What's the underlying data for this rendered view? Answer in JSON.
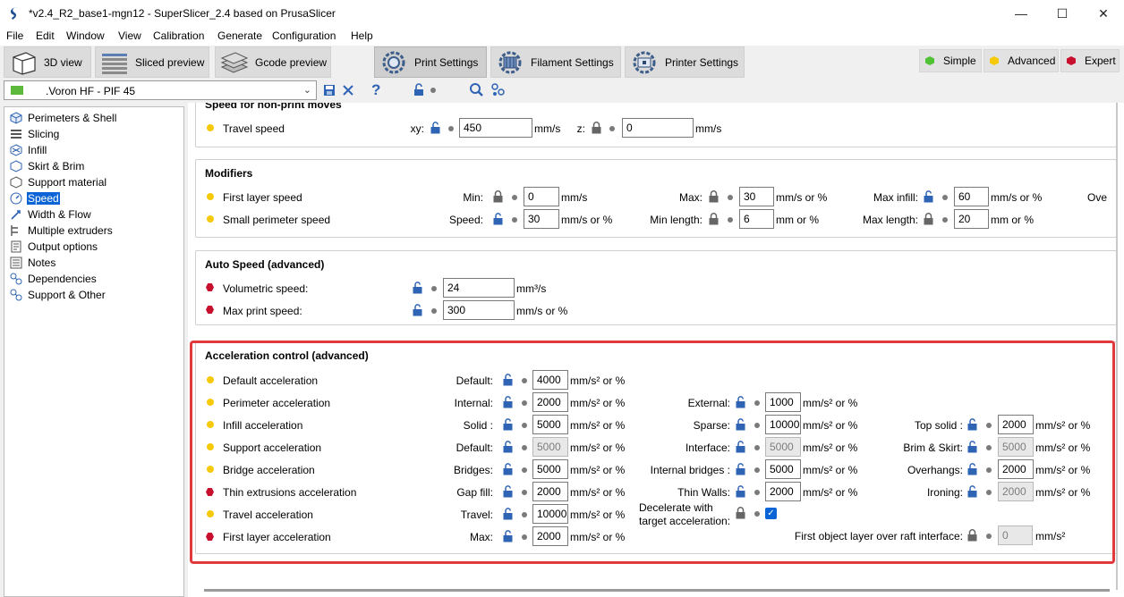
{
  "window": {
    "title": "*v2.4_R2_base1-mgn12 - SuperSlicer_2.4  based on PrusaSlicer",
    "minimize": "—",
    "maximize": "☐",
    "close": "✕"
  },
  "menu": [
    "File",
    "Edit",
    "Window",
    "View",
    "Calibration",
    "Generate",
    "Configuration",
    "Help"
  ],
  "toolbar": {
    "view3d": "3D view",
    "sliced": "Sliced preview",
    "gcode": "Gcode preview",
    "print": "Print Settings",
    "filament": "Filament Settings",
    "printer": "Printer Settings"
  },
  "modes": {
    "simple": "Simple",
    "advanced": "Advanced",
    "expert": "Expert",
    "colors": {
      "simple": "#4fc234",
      "advanced": "#f6ca0b",
      "expert": "#c8102e"
    }
  },
  "preset": {
    "value": ".Voron HF - PIF 45"
  },
  "nav": [
    {
      "label": "Perimeters & Shell",
      "icon": "shell-icon"
    },
    {
      "label": "Slicing",
      "icon": "layers-icon"
    },
    {
      "label": "Infill",
      "icon": "infill-icon"
    },
    {
      "label": "Skirt & Brim",
      "icon": "skirt-icon"
    },
    {
      "label": "Support material",
      "icon": "support-icon"
    },
    {
      "label": "Speed",
      "icon": "speed-icon"
    },
    {
      "label": "Width & Flow",
      "icon": "flow-icon"
    },
    {
      "label": "Multiple extruders",
      "icon": "extruders-icon"
    },
    {
      "label": "Output options",
      "icon": "output-icon"
    },
    {
      "label": "Notes",
      "icon": "notes-icon"
    },
    {
      "label": "Dependencies",
      "icon": "dependencies-icon"
    },
    {
      "label": "Support & Other",
      "icon": "support-other-icon"
    }
  ],
  "sections": {
    "nonprint": {
      "title": "Speed for non-print moves",
      "travel_label": "Travel speed",
      "xy_label": "xy:",
      "xy_value": "450",
      "xy_unit": "mm/s",
      "z_label": "z:",
      "z_value": "0",
      "z_unit": "mm/s"
    },
    "modifiers": {
      "title": "Modifiers",
      "first_label": "First layer speed",
      "min_label": "Min:",
      "min_value": "0",
      "min_unit": "mm/s",
      "max_label": "Max:",
      "max_value": "30",
      "max_unit": "mm/s or %",
      "maxinfill_label": "Max infill:",
      "maxinfill_value": "60",
      "maxinfill_unit": "mm/s or %",
      "over_label": "Ove",
      "small_label": "Small perimeter speed",
      "speed_label": "Speed:",
      "speed_value": "30",
      "speed_unit": "mm/s or %",
      "minlen_label": "Min length:",
      "minlen_value": "6",
      "minlen_unit": "mm or %",
      "maxlen_label": "Max length:",
      "maxlen_value": "20",
      "maxlen_unit": "mm or %"
    },
    "auto": {
      "title": "Auto Speed (advanced)",
      "vol_label": "Volumetric speed:",
      "vol_value": "24",
      "vol_unit": "mm³/s",
      "maxprint_label": "Max print speed:",
      "maxprint_value": "300",
      "maxprint_unit": "mm/s or %"
    },
    "accel": {
      "title": "Acceleration control (advanced)",
      "unit": "mm/s² or %",
      "unit_plain": "mm/s²",
      "rows": [
        {
          "label": "Default acceleration",
          "mode": "advanced",
          "c1": {
            "label": "Default:",
            "value": "4000",
            "disabled": false
          }
        },
        {
          "label": "Perimeter acceleration",
          "mode": "advanced",
          "c1": {
            "label": "Internal:",
            "value": "2000",
            "disabled": false
          },
          "c2": {
            "label": "External:",
            "value": "1000",
            "disabled": false
          }
        },
        {
          "label": "Infill acceleration",
          "mode": "advanced",
          "c1": {
            "label": "Solid :",
            "value": "5000",
            "disabled": false
          },
          "c2": {
            "label": "Sparse:",
            "value": "10000",
            "disabled": false
          },
          "c3": {
            "label": "Top solid :",
            "value": "2000",
            "disabled": false
          }
        },
        {
          "label": "Support acceleration",
          "mode": "advanced",
          "c1": {
            "label": "Default:",
            "value": "5000",
            "disabled": true
          },
          "c2": {
            "label": "Interface:",
            "value": "5000",
            "disabled": true
          },
          "c3": {
            "label": "Brim & Skirt:",
            "value": "5000",
            "disabled": true
          }
        },
        {
          "label": "Bridge acceleration",
          "mode": "advanced",
          "c1": {
            "label": "Bridges:",
            "value": "5000",
            "disabled": false
          },
          "c2": {
            "label": "Internal bridges :",
            "value": "5000",
            "disabled": false
          },
          "c3": {
            "label": "Overhangs:",
            "value": "2000",
            "disabled": false
          }
        },
        {
          "label": "Thin extrusions acceleration",
          "mode": "expert",
          "c1": {
            "label": "Gap fill:",
            "value": "2000",
            "disabled": false
          },
          "c2": {
            "label": "Thin Walls:",
            "value": "2000",
            "disabled": false
          },
          "c3": {
            "label": "Ironing:",
            "value": "2000",
            "disabled": true
          }
        },
        {
          "label": "Travel acceleration",
          "mode": "advanced",
          "c1": {
            "label": "Travel:",
            "value": "10000",
            "disabled": false
          }
        },
        {
          "label": "First layer acceleration",
          "mode": "expert",
          "c1": {
            "label": "Max:",
            "value": "2000",
            "disabled": false
          }
        }
      ],
      "decel_label_1": "Decelerate with",
      "decel_label_2": "target acceleration:",
      "decel_checked": true,
      "raft_label": "First object layer over raft interface:",
      "raft_value": "0"
    }
  }
}
